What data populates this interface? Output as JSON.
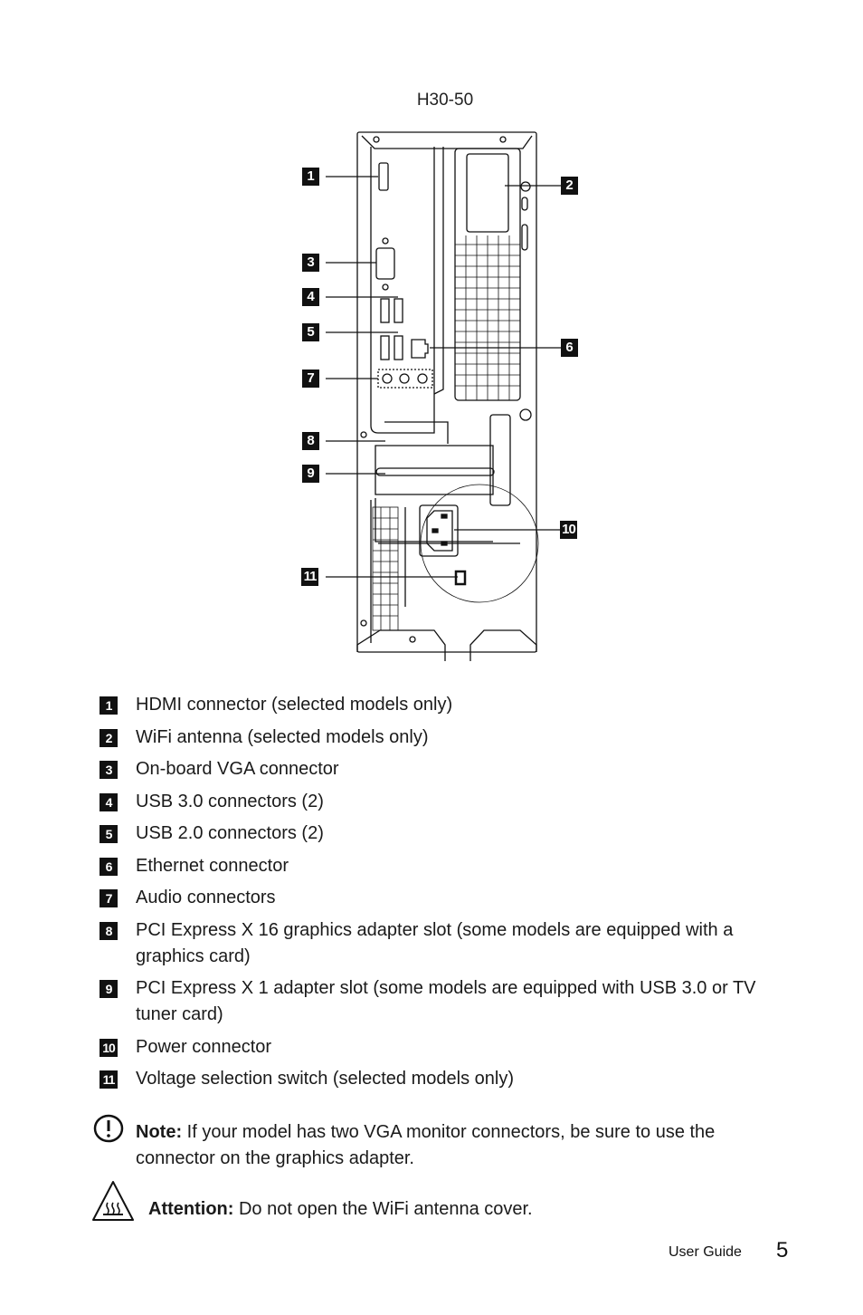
{
  "figure": {
    "title": "H30-50",
    "callouts": [
      "1",
      "2",
      "3",
      "4",
      "5",
      "6",
      "7",
      "8",
      "9",
      "10",
      "11"
    ]
  },
  "legend": {
    "items": [
      {
        "number": "1",
        "label": "HDMI connector (selected models only)"
      },
      {
        "number": "2",
        "label": "WiFi antenna (selected models only)"
      },
      {
        "number": "3",
        "label": "On-board VGA connector"
      },
      {
        "number": "4",
        "label": "USB 3.0 connectors (2)"
      },
      {
        "number": "5",
        "label": "USB 2.0 connectors (2)"
      },
      {
        "number": "6",
        "label": "Ethernet connector"
      },
      {
        "number": "7",
        "label": "Audio connectors"
      },
      {
        "number": "8",
        "label": "PCI Express X 16 graphics adapter slot (some models are equipped with a graphics card)"
      },
      {
        "number": "9",
        "label": "PCI Express X 1 adapter slot (some models are equipped with USB 3.0 or TV tuner card)"
      },
      {
        "number": "10",
        "label": "Power connector"
      },
      {
        "number": "11",
        "label": "Voltage selection switch (selected models only)"
      }
    ]
  },
  "note": {
    "icon": "exclamation-circle-icon",
    "label": "Note:",
    "text": " If your model has two VGA monitor connectors, be sure to use the connector on the graphics adapter."
  },
  "attention": {
    "icon": "hot-surface-warning-icon",
    "label": "Attention:",
    "text": " Do not open the WiFi antenna cover."
  },
  "footer": {
    "label": "User Guide",
    "page_number": "5"
  }
}
